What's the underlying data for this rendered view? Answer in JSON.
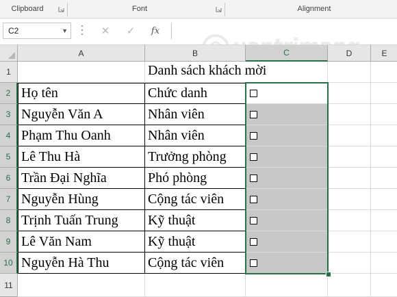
{
  "ribbon": {
    "groups": [
      "Clipboard",
      "Font",
      "Alignment"
    ]
  },
  "formula_bar": {
    "name_box": "C2",
    "cancel_icon": "✕",
    "enter_icon": "✓",
    "fx_label": "fx",
    "formula": ""
  },
  "watermark": {
    "text": "uantrimang"
  },
  "grid": {
    "columns": [
      "A",
      "B",
      "C",
      "D",
      "E"
    ],
    "rows": [
      "1",
      "2",
      "3",
      "4",
      "5",
      "6",
      "7",
      "8",
      "9",
      "10",
      "11"
    ],
    "selected_cell": "C2"
  },
  "sheet": {
    "title": "Danh sách khách mời",
    "header": {
      "name": "Họ tên",
      "position": "Chức danh"
    },
    "entries": [
      {
        "name": "Nguyễn Văn A",
        "position": "Nhân viên"
      },
      {
        "name": "Phạm Thu Oanh",
        "position": "Nhân viên"
      },
      {
        "name": "Lê Thu Hà",
        "position": "Trưởng phòng"
      },
      {
        "name": "Trần Đại Nghĩa",
        "position": "Phó phòng"
      },
      {
        "name": "Nguyễn Hùng",
        "position": "Cộng tác viên"
      },
      {
        "name": "Trịnh Tuấn Trung",
        "position": "Kỹ thuật"
      },
      {
        "name": "Lê Văn Nam",
        "position": "Kỹ thuật"
      },
      {
        "name": "Nguyễn Hà Thu",
        "position": "Cộng tác viên"
      }
    ]
  },
  "colors": {
    "accent": "#217346",
    "shade": "#c8c8c8",
    "header_bg": "#e6e6e6"
  }
}
